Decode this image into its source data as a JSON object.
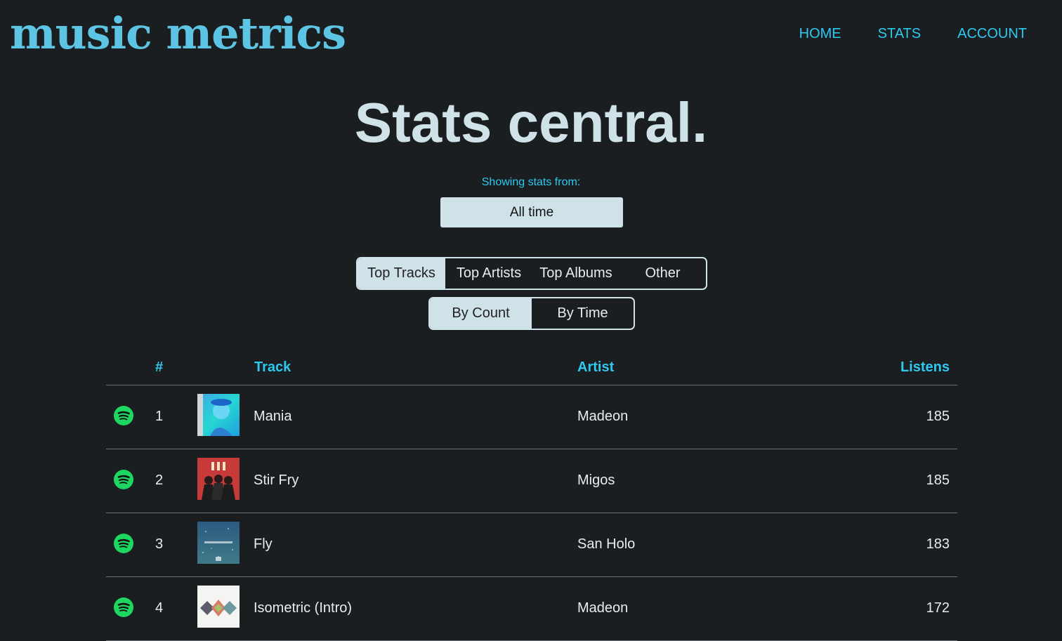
{
  "header": {
    "logo": "music metrics",
    "nav": [
      "HOME",
      "STATS",
      "ACCOUNT"
    ]
  },
  "hero": {
    "title": "Stats central."
  },
  "range": {
    "label": "Showing stats from:",
    "value": "All time"
  },
  "tabs": [
    "Top Tracks",
    "Top Artists",
    "Top Albums",
    "Other"
  ],
  "active_tab": "Top Tracks",
  "sort": [
    "By Count",
    "By Time"
  ],
  "active_sort": "By Count",
  "table": {
    "headers": {
      "rank": "#",
      "track": "Track",
      "artist": "Artist",
      "listens": "Listens"
    },
    "rows": [
      {
        "rank": "1",
        "track": "Mania",
        "artist": "Madeon",
        "listens": "185",
        "art_icon": "album-art-mania"
      },
      {
        "rank": "2",
        "track": "Stir Fry",
        "artist": "Migos",
        "listens": "185",
        "art_icon": "album-art-culture-ii"
      },
      {
        "rank": "3",
        "track": "Fly",
        "artist": "San Holo",
        "listens": "183",
        "art_icon": "album-art-cosmos"
      },
      {
        "rank": "4",
        "track": "Isometric (Intro)",
        "artist": "Madeon",
        "listens": "172",
        "art_icon": "album-art-adventure"
      }
    ]
  },
  "colors": {
    "background": "#1b1e20",
    "accent": "#2dc9f0",
    "logo": "#5ec4e3",
    "light": "#cfe2e8",
    "spotify_green": "#1ed760"
  }
}
